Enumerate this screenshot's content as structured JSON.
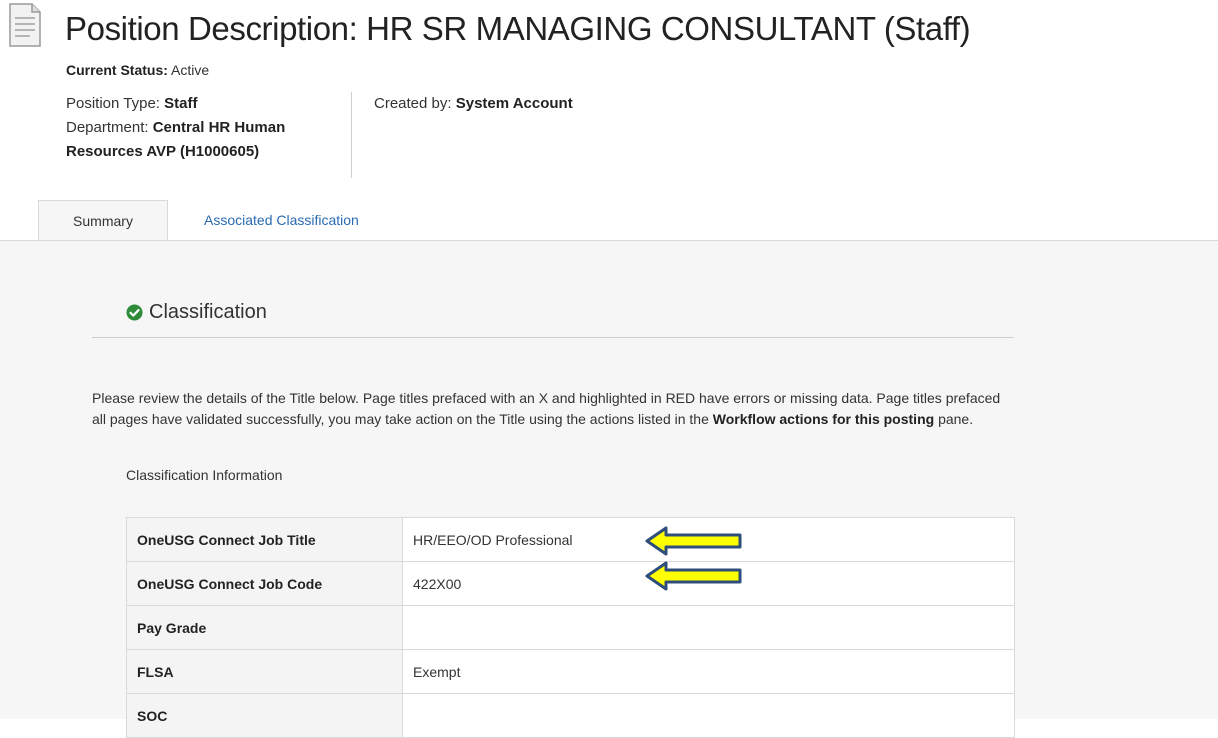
{
  "header": {
    "title": "Position Description: HR SR MANAGING CONSULTANT (Staff)",
    "status_label": "Current Status:",
    "status_value": "Active",
    "position_type_label": "Position Type:",
    "position_type_value": "Staff",
    "department_label": "Department:",
    "department_value": "Central HR Human Resources AVP (H1000605)",
    "created_by_label": "Created by:",
    "created_by_value": "System Account"
  },
  "tabs": [
    {
      "label": "Summary",
      "active": true
    },
    {
      "label": "Associated Classification",
      "active": false
    }
  ],
  "section": {
    "title": "Classification",
    "icon": "check-circle-icon",
    "status_color": "#2e8b3a"
  },
  "instructions": {
    "line1": "Please review the details of the Title below.  Page titles prefaced with an X and highlighted in RED have errors or missing data.  Page titles prefaced",
    "line2_pre": "all pages have validated successfully, you may take action on the Title using the actions listed in the ",
    "line2_bold": "Workflow actions for this posting",
    "line2_post": " pane."
  },
  "classification": {
    "heading": "Classification Information",
    "rows": [
      {
        "label": "OneUSG Connect Job Title",
        "value": "HR/EEO/OD Professional"
      },
      {
        "label": "OneUSG Connect Job Code",
        "value": "422X00"
      },
      {
        "label": "Pay Grade",
        "value": ""
      },
      {
        "label": "FLSA",
        "value": "Exempt"
      },
      {
        "label": "SOC",
        "value": ""
      }
    ]
  },
  "annotations": {
    "arrow_fill": "#ffff00",
    "arrow_stroke": "#2f4d7a"
  }
}
